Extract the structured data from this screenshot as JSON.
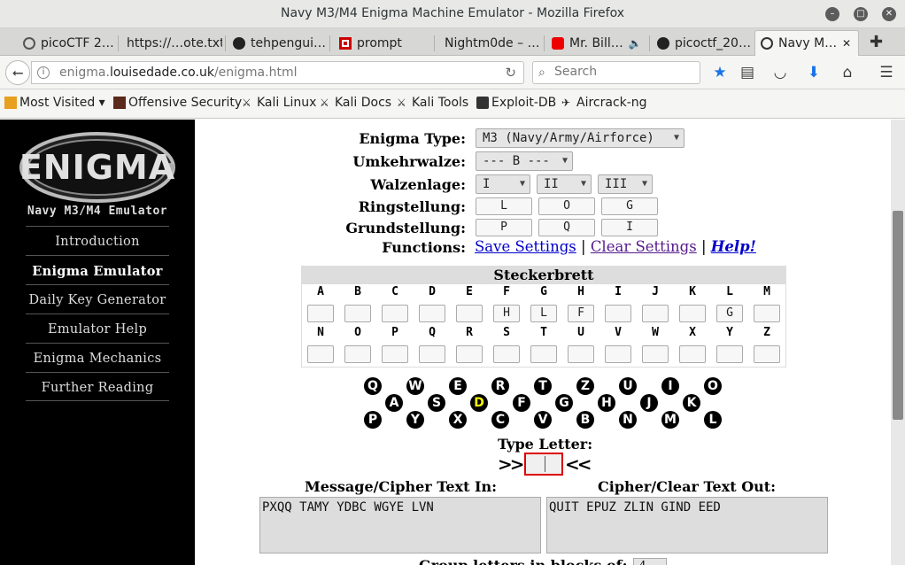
{
  "window": {
    "title": "Navy M3/M4 Enigma Machine Emulator - Mozilla Firefox"
  },
  "tabs": [
    {
      "label": "picoCTF 2…",
      "icon": "picoctf-icon"
    },
    {
      "label": "https://…ote.txt",
      "icon": ""
    },
    {
      "label": "tehpengui…",
      "icon": "github-icon"
    },
    {
      "label": "prompt",
      "icon": "prompt-icon"
    },
    {
      "label": "Nightm0de – …",
      "icon": ""
    },
    {
      "label": "Mr. Bill…",
      "icon": "youtube-icon"
    },
    {
      "label": "picoctf_20…",
      "icon": "github-icon"
    },
    {
      "label": "Navy M…",
      "icon": "enigma-favicon"
    }
  ],
  "nav": {
    "url_prefix": "enigma.",
    "url_domain": "louisedade.co.uk",
    "url_path": "/enigma.html",
    "search_placeholder": "Search"
  },
  "bookmarks": [
    {
      "label": "Most Visited ▾",
      "icon": "most-visited-icon"
    },
    {
      "label": "Offensive Security",
      "icon": "offsec-icon"
    },
    {
      "label": "Kali Linux",
      "icon": "kali-icon"
    },
    {
      "label": "Kali Docs",
      "icon": "kali-icon"
    },
    {
      "label": "Kali Tools",
      "icon": "kali-icon"
    },
    {
      "label": "Exploit-DB",
      "icon": "exploitdb-icon"
    },
    {
      "label": "Aircrack-ng",
      "icon": "aircrack-icon"
    }
  ],
  "sidebar": {
    "logo_text": "ENIGMA",
    "subtitle": "Navy M3/M4 Emulator",
    "menu": [
      "Introduction",
      "Enigma Emulator",
      "Daily Key Generator",
      "Emulator Help",
      "Enigma Mechanics",
      "Further Reading"
    ],
    "current": "Enigma Emulator"
  },
  "settings": {
    "labels": {
      "type": "Enigma Type:",
      "reflector": "Umkehrwalze:",
      "rotors": "Walzenlage:",
      "rings": "Ringstellung:",
      "ground": "Grundstellung:",
      "functions": "Functions:"
    },
    "type": "M3 (Navy/Army/Airforce)",
    "reflector": "--- B ---",
    "rotors": [
      "I",
      "II",
      "III"
    ],
    "rings": [
      "L",
      "O",
      "G"
    ],
    "ground": [
      "P",
      "Q",
      "I"
    ],
    "functions": {
      "save": "Save Settings",
      "clear": "Clear Settings",
      "help": "Help!",
      "sep": "|"
    }
  },
  "plugboard": {
    "title": "Steckerbrett",
    "row1": [
      {
        "letter": "A",
        "value": ""
      },
      {
        "letter": "B",
        "value": ""
      },
      {
        "letter": "C",
        "value": ""
      },
      {
        "letter": "D",
        "value": ""
      },
      {
        "letter": "E",
        "value": ""
      },
      {
        "letter": "F",
        "value": "H"
      },
      {
        "letter": "G",
        "value": "L"
      },
      {
        "letter": "H",
        "value": "F"
      },
      {
        "letter": "I",
        "value": ""
      },
      {
        "letter": "J",
        "value": ""
      },
      {
        "letter": "K",
        "value": ""
      },
      {
        "letter": "L",
        "value": "G"
      },
      {
        "letter": "M",
        "value": ""
      }
    ],
    "row2": [
      {
        "letter": "N",
        "value": ""
      },
      {
        "letter": "O",
        "value": ""
      },
      {
        "letter": "P",
        "value": ""
      },
      {
        "letter": "Q",
        "value": ""
      },
      {
        "letter": "R",
        "value": ""
      },
      {
        "letter": "S",
        "value": ""
      },
      {
        "letter": "T",
        "value": ""
      },
      {
        "letter": "U",
        "value": ""
      },
      {
        "letter": "V",
        "value": ""
      },
      {
        "letter": "W",
        "value": ""
      },
      {
        "letter": "X",
        "value": ""
      },
      {
        "letter": "Y",
        "value": ""
      },
      {
        "letter": "Z",
        "value": ""
      }
    ]
  },
  "lampboard": {
    "row1": [
      "Q",
      "W",
      "E",
      "R",
      "T",
      "Z",
      "U",
      "I",
      "O"
    ],
    "row2": [
      "A",
      "S",
      "D",
      "F",
      "G",
      "H",
      "J",
      "K"
    ],
    "row3": [
      "P",
      "Y",
      "X",
      "C",
      "V",
      "B",
      "N",
      "M",
      "L"
    ],
    "lit": "D",
    "lit_color": "#ffff00"
  },
  "typing": {
    "label": "Type Letter:",
    "left_arrows": ">>",
    "right_arrows": "<<",
    "value": ""
  },
  "messages": {
    "in_label": "Message/Cipher Text In:",
    "out_label": "Cipher/Clear Text Out:",
    "in_text": "PXQQ TAMY YDBC WGYE LVN",
    "out_text": "QUIT EPUZ ZLIN GIND EED"
  },
  "grouping": {
    "label": "Group letters in blocks of:",
    "value": "4"
  }
}
